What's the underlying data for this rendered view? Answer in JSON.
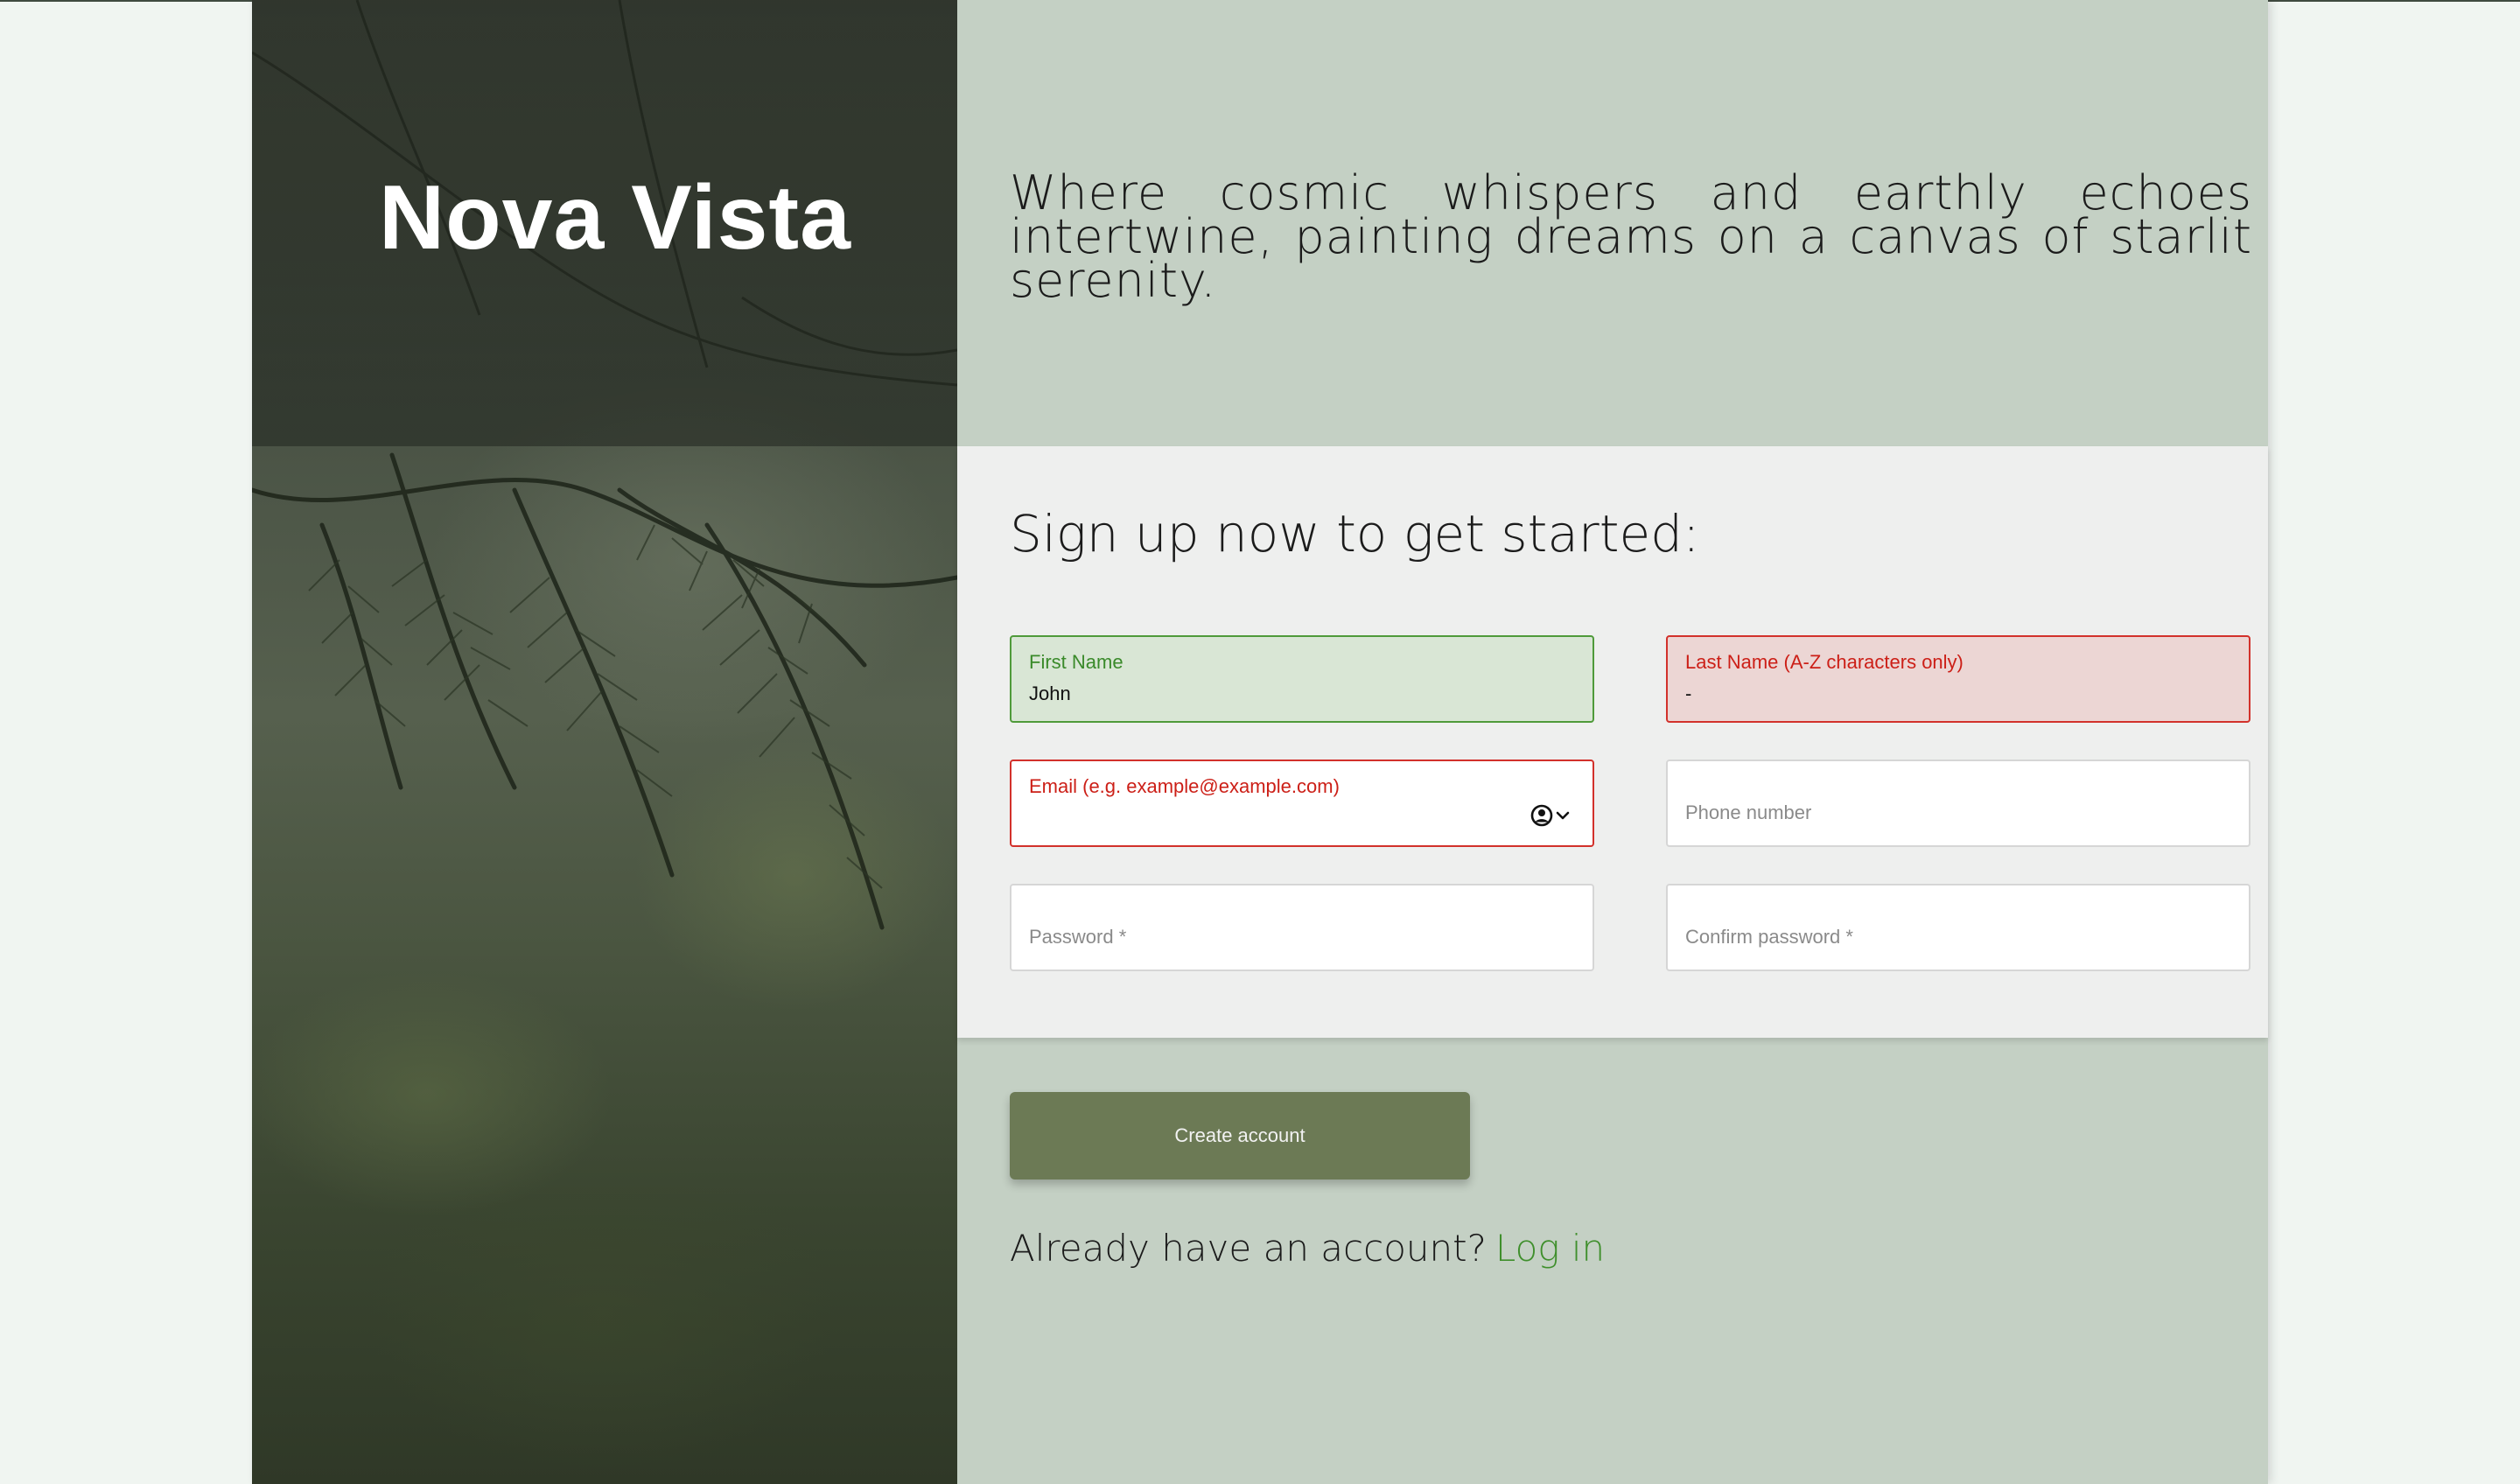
{
  "brand": {
    "name": "Nova Vista"
  },
  "hero": {
    "tagline": "Where cosmic whispers and earthly echoes intertwine, painting dreams on a canvas of starlit serenity."
  },
  "signup": {
    "title": "Sign up now to get started:",
    "fields": {
      "first_name": {
        "label": "First Name",
        "value": "John",
        "state": "valid"
      },
      "last_name": {
        "label": "Last Name (A-Z characters only)",
        "value": "-",
        "state": "invalid"
      },
      "email": {
        "label": "Email (e.g. example@example.com)",
        "value": "",
        "state": "invalid",
        "autofill_icon": "contact-card-icon"
      },
      "phone": {
        "placeholder": "Phone number"
      },
      "password": {
        "placeholder": "Password *"
      },
      "confirm_password": {
        "placeholder": "Confirm password *"
      }
    },
    "submit_label": "Create account",
    "login_prompt": "Already have an account?",
    "login_link": "Log in"
  },
  "colors": {
    "page_bg": "#f0f5f1",
    "panel_bg": "#c4d0c4",
    "form_bg": "#eeefee",
    "accent_green": "#3f8f2c",
    "error_red": "#cc1f17",
    "button_bg": "#6c7a55"
  }
}
